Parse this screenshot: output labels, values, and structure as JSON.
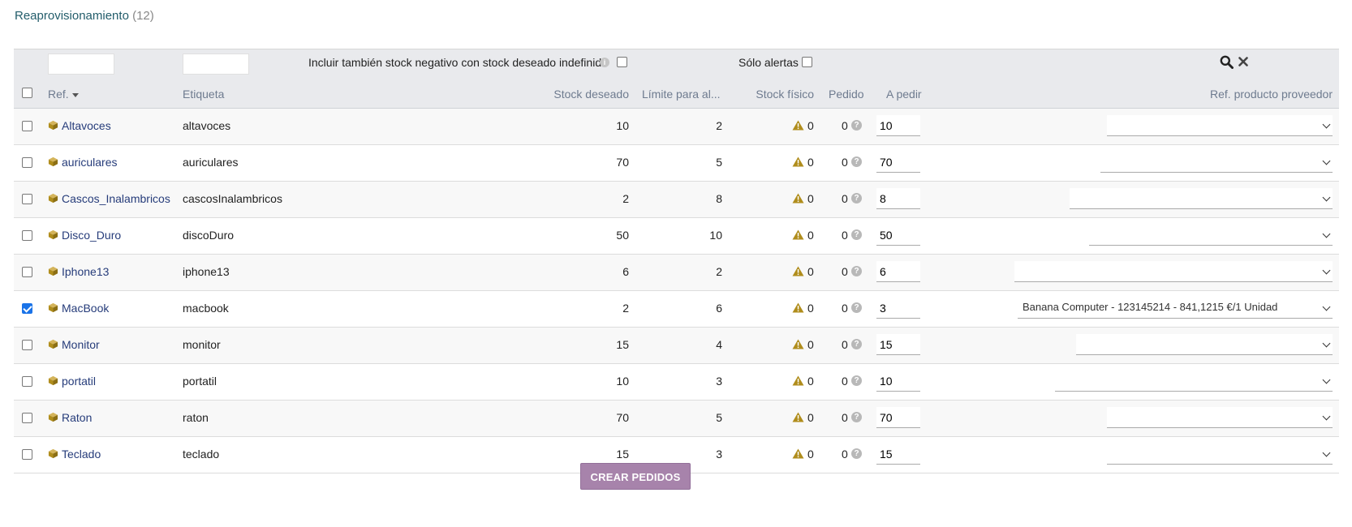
{
  "page": {
    "title": "Reaprovisionamiento",
    "count": "(12)"
  },
  "filters": {
    "include_negative_label": "Incluir también stock negativo con stock deseado indefinido",
    "only_alerts_label": "Sólo alertas"
  },
  "columns": {
    "ref": "Ref.",
    "label": "Etiqueta",
    "desired_stock": "Stock deseado",
    "alert_limit": "Límite para al...",
    "physical_stock": "Stock físico",
    "ordered": "Pedido",
    "to_order": "A pedir",
    "supplier_ref": "Ref. producto proveedor"
  },
  "rows": [
    {
      "ref": "Altavoces",
      "label": "altavoces",
      "desired": "10",
      "limit": "2",
      "physical": "0",
      "ordered": "0",
      "to_order": "10",
      "supplier": "",
      "checked": false
    },
    {
      "ref": "auriculares",
      "label": "auriculares",
      "desired": "70",
      "limit": "5",
      "physical": "0",
      "ordered": "0",
      "to_order": "70",
      "supplier": "",
      "checked": false
    },
    {
      "ref": "Cascos_Inalambricos",
      "label": "cascosInalambricos",
      "desired": "2",
      "limit": "8",
      "physical": "0",
      "ordered": "0",
      "to_order": "8",
      "supplier": "",
      "checked": false
    },
    {
      "ref": "Disco_Duro",
      "label": "discoDuro",
      "desired": "50",
      "limit": "10",
      "physical": "0",
      "ordered": "0",
      "to_order": "50",
      "supplier": "",
      "checked": false
    },
    {
      "ref": "Iphone13",
      "label": "iphone13",
      "desired": "6",
      "limit": "2",
      "physical": "0",
      "ordered": "0",
      "to_order": "6",
      "supplier": "",
      "checked": false
    },
    {
      "ref": "MacBook",
      "label": "macbook",
      "desired": "2",
      "limit": "6",
      "physical": "0",
      "ordered": "0",
      "to_order": "3",
      "supplier": "Banana Computer - 123145214 - 841,1215 €/1 Unidad",
      "checked": true
    },
    {
      "ref": "Monitor",
      "label": "monitor",
      "desired": "15",
      "limit": "4",
      "physical": "0",
      "ordered": "0",
      "to_order": "15",
      "supplier": "",
      "checked": false
    },
    {
      "ref": "portatil",
      "label": "portatil",
      "desired": "10",
      "limit": "3",
      "physical": "0",
      "ordered": "0",
      "to_order": "10",
      "supplier": "",
      "checked": false
    },
    {
      "ref": "Raton",
      "label": "raton",
      "desired": "70",
      "limit": "5",
      "physical": "0",
      "ordered": "0",
      "to_order": "70",
      "supplier": "",
      "checked": false
    },
    {
      "ref": "Teclado",
      "label": "teclado",
      "desired": "15",
      "limit": "3",
      "physical": "0",
      "ordered": "0",
      "to_order": "15",
      "supplier": "",
      "checked": false
    }
  ],
  "actions": {
    "create_orders": "CREAR PEDIDOS"
  },
  "colors": {
    "accent": "#a783ab",
    "link": "#263c7a",
    "title": "#235d6b",
    "warning": "#b08d1c"
  },
  "icons": {
    "product": "box-icon",
    "warning": "warning-icon",
    "help": "question-icon",
    "search": "search-icon",
    "clear": "close-icon"
  }
}
